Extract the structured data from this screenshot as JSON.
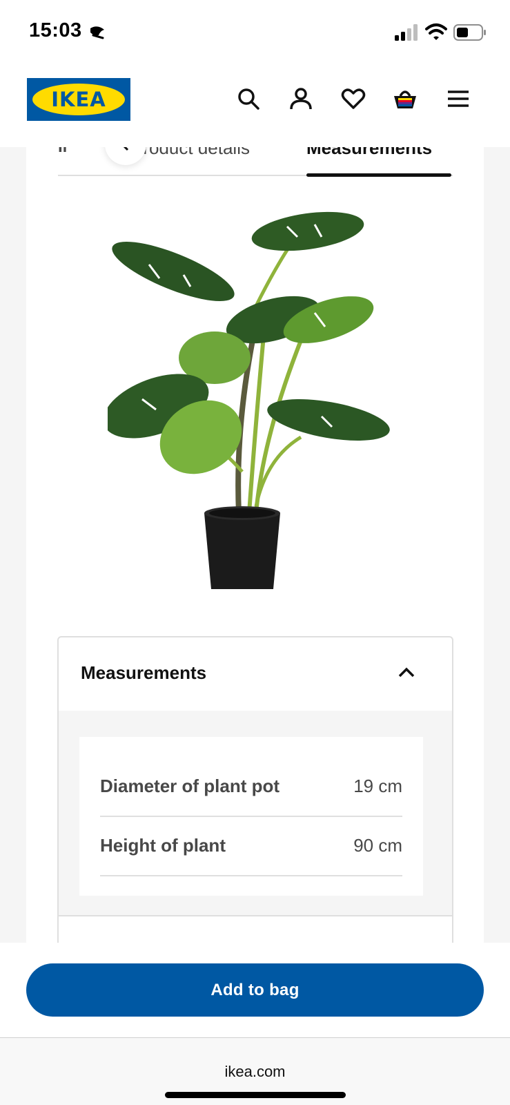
{
  "status_bar": {
    "time": "15:03",
    "icons": [
      "moon-icon",
      "signal-icon",
      "wifi-icon",
      "battery-icon"
    ]
  },
  "header": {
    "logo_text": "IKEA",
    "icons": [
      "search-icon",
      "user-icon",
      "heart-icon",
      "basket-icon",
      "menu-icon"
    ]
  },
  "tabs": {
    "items": [
      {
        "label": "Product details",
        "active": false
      },
      {
        "label": "Measurements",
        "active": true
      }
    ],
    "back_icon": "chevron-left-icon"
  },
  "product": {
    "image_icon": "plant-image"
  },
  "measurements": {
    "title": "Measurements",
    "expanded": true,
    "rows": [
      {
        "label": "Diameter of plant pot",
        "value": "19 cm"
      },
      {
        "label": "Height of plant",
        "value": "90 cm"
      }
    ]
  },
  "actions": {
    "add_to_bag": "Add to bag"
  },
  "browser": {
    "url": "ikea.com"
  },
  "colors": {
    "ikea_blue": "#0058a3",
    "ikea_yellow": "#ffdb00",
    "text_primary": "#111111",
    "text_secondary": "#484848",
    "border": "#dfdfdf",
    "background": "#f5f5f5"
  }
}
